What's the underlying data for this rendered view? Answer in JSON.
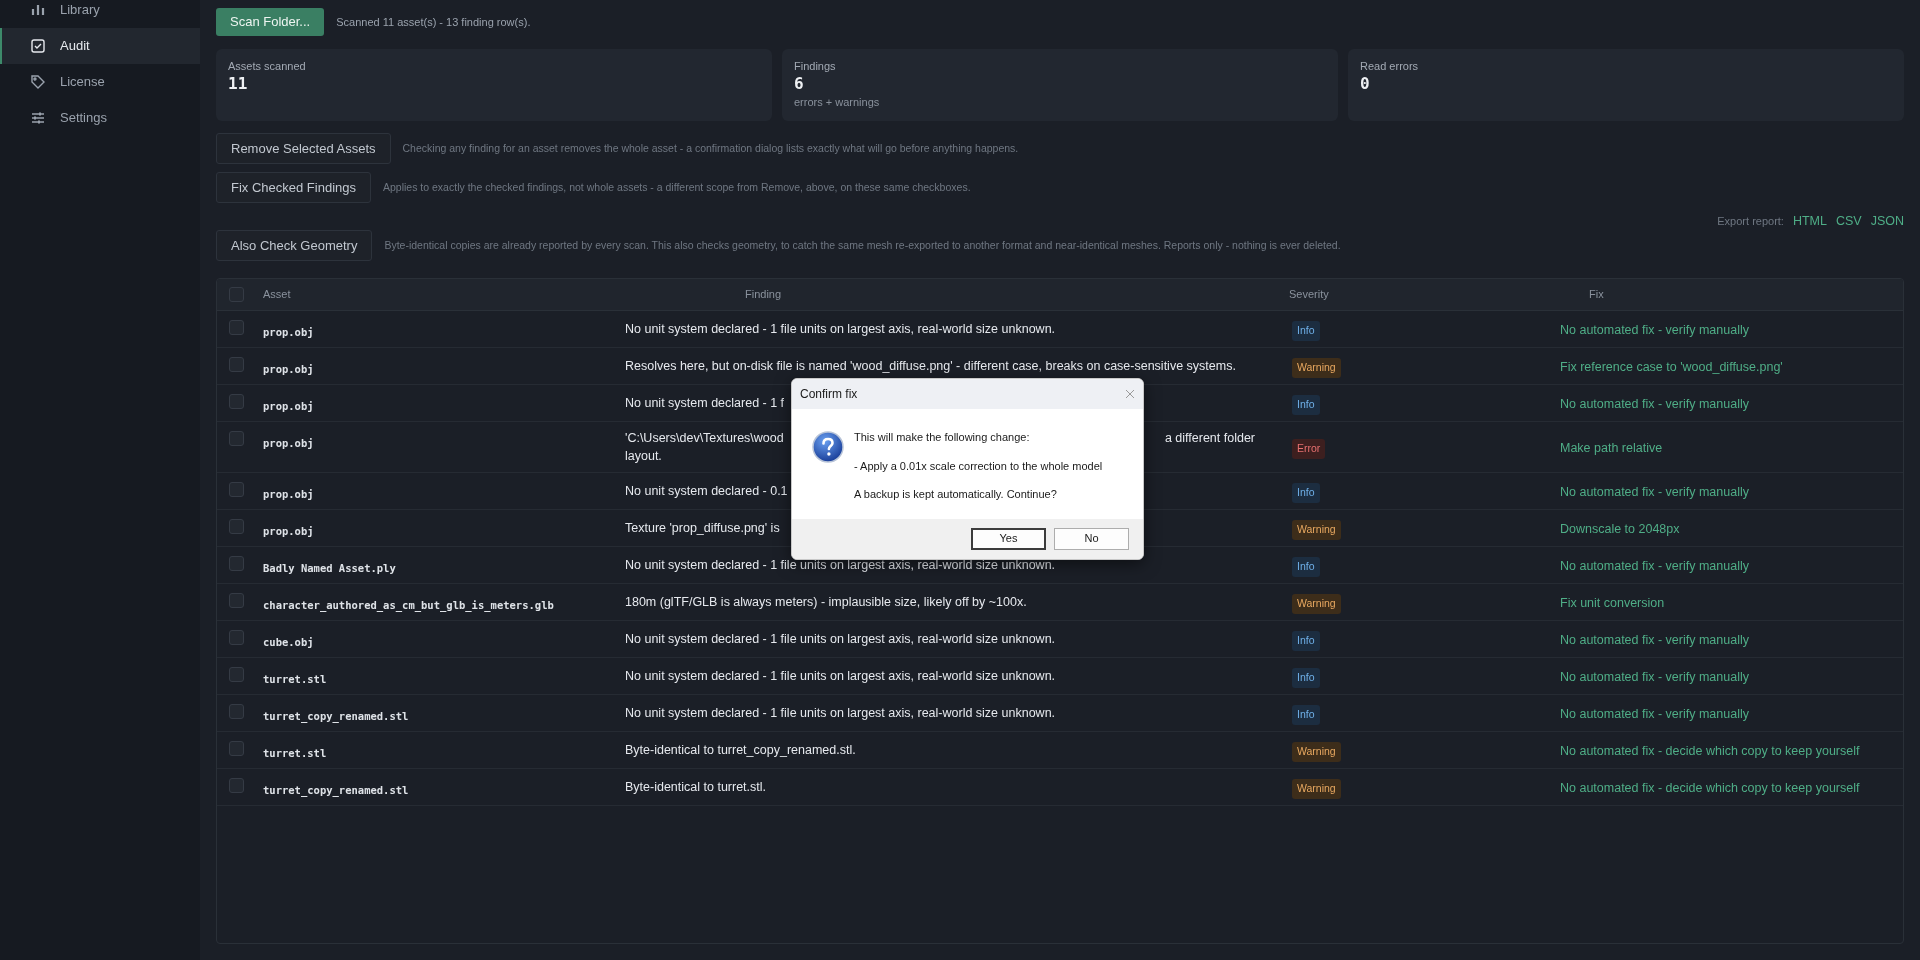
{
  "sidebar": {
    "items": [
      {
        "label": "Library",
        "selected": false
      },
      {
        "label": "Audit",
        "selected": true
      },
      {
        "label": "License",
        "selected": false
      },
      {
        "label": "Settings",
        "selected": false
      }
    ]
  },
  "toolbar": {
    "scan_button": "Scan Folder...",
    "status": "Scanned 11 asset(s) - 13 finding row(s)."
  },
  "stats": [
    {
      "label": "Assets scanned",
      "value": "11"
    },
    {
      "label": "Findings",
      "value": "6",
      "note": "errors + warnings"
    },
    {
      "label": "Read errors",
      "value": "0"
    }
  ],
  "actions": [
    {
      "button": "Remove Selected Assets",
      "description": "Checking any finding for an asset removes the whole asset - a confirmation dialog lists exactly what will go before anything happens."
    },
    {
      "button": "Fix Checked Findings",
      "description": "Applies to exactly the checked findings, not whole assets - a different scope from Remove, above, on these same checkboxes."
    }
  ],
  "export": {
    "label": "Export report:",
    "links": [
      "HTML",
      "CSV",
      "JSON"
    ]
  },
  "geometry": {
    "button": "Also Check Geometry",
    "description": "Byte-identical copies are already reported by every scan. This also checks geometry, to catch the same mesh re-exported to another format and near-identical meshes. Reports only - nothing is ever deleted."
  },
  "table": {
    "all_checked": false,
    "columns": [
      "Asset",
      "Finding",
      "Severity",
      "Fix"
    ],
    "rows": [
      {
        "checked": false,
        "asset": "prop.obj",
        "finding": "No unit system declared - 1 file units on largest axis, real-world size unknown.",
        "severity": "Info",
        "kind": "info",
        "fix": "No automated fix - verify manually"
      },
      {
        "checked": false,
        "asset": "prop.obj",
        "finding": "Resolves here, but on-disk file is named 'wood_diffuse.png' - different case, breaks on case-sensitive systems.",
        "severity": "Warning",
        "kind": "warning",
        "fix": "Fix reference case to 'wood_diffuse.png'"
      },
      {
        "checked": false,
        "asset": "prop.obj",
        "finding": "No unit system declared - 1 f",
        "severity": "Info",
        "kind": "info",
        "fix": "No automated fix - verify manually"
      },
      {
        "checked": false,
        "asset": "prop.obj",
        "finding": "'C:\\Users\\dev\\Textures\\wood",
        "finding_after_dialog": "a different folder",
        "finding_line_2": "layout.",
        "severity": "Error",
        "kind": "error",
        "fix": "Make path relative"
      },
      {
        "checked": false,
        "asset": "prop.obj",
        "finding": "No unit system declared - 0.1",
        "severity": "Info",
        "kind": "info",
        "fix": "No automated fix - verify manually"
      },
      {
        "checked": false,
        "asset": "prop.obj",
        "finding": "Texture 'prop_diffuse.png' is",
        "severity": "Warning",
        "kind": "warning",
        "fix": "Downscale to 2048px"
      },
      {
        "checked": false,
        "asset": "Badly Named Asset.ply",
        "finding": "No unit system declared - 1 file units on largest axis, real-world size unknown.",
        "severity": "Info",
        "kind": "info",
        "fix": "No automated fix - verify manually"
      },
      {
        "checked": false,
        "asset": "character_authored_as_cm_but_glb_is_meters.glb",
        "finding": "180m (glTF/GLB is always meters) - implausible size, likely off by ~100x.",
        "severity": "Warning",
        "kind": "warning",
        "fix": "Fix unit conversion"
      },
      {
        "checked": false,
        "asset": "cube.obj",
        "finding": "No unit system declared - 1 file units on largest axis, real-world size unknown.",
        "severity": "Info",
        "kind": "info",
        "fix": "No automated fix - verify manually"
      },
      {
        "checked": false,
        "asset": "turret.stl",
        "finding": "No unit system declared - 1 file units on largest axis, real-world size unknown.",
        "severity": "Info",
        "kind": "info",
        "fix": "No automated fix - verify manually"
      },
      {
        "checked": false,
        "asset": "turret_copy_renamed.stl",
        "finding": "No unit system declared - 1 file units on largest axis, real-world size unknown.",
        "severity": "Info",
        "kind": "info",
        "fix": "No automated fix - verify manually"
      },
      {
        "checked": false,
        "asset": "turret.stl",
        "finding": "Byte-identical to turret_copy_renamed.stl.",
        "severity": "Warning",
        "kind": "warning",
        "fix": "No automated fix - decide which copy to keep yourself"
      },
      {
        "checked": false,
        "asset": "turret_copy_renamed.stl",
        "finding": "Byte-identical to turret.stl.",
        "severity": "Warning",
        "kind": "warning",
        "fix": "No automated fix - decide which copy to keep yourself"
      }
    ]
  },
  "dialog": {
    "title": "Confirm fix",
    "lines": [
      "This will make the following change:",
      "- Apply a 0.01x scale correction to the whole model",
      "A backup is kept automatically. Continue?"
    ],
    "buttons": [
      {
        "label": "Yes",
        "selected": true
      },
      {
        "label": "No",
        "selected": false
      }
    ]
  }
}
